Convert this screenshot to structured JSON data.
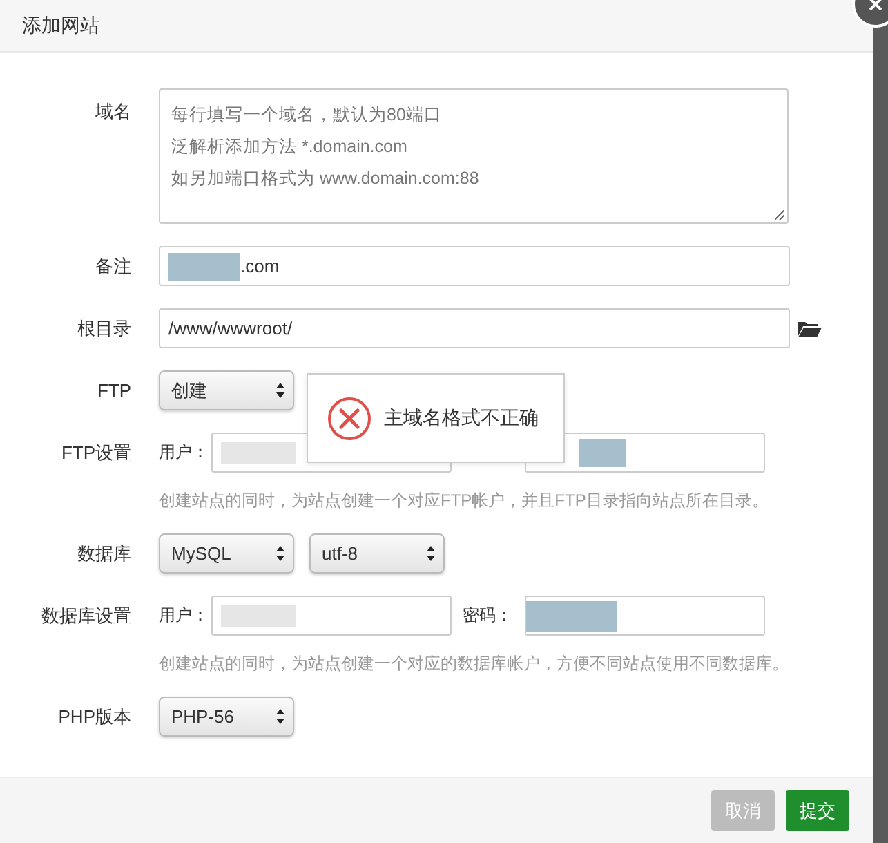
{
  "dialog": {
    "title": "添加网站"
  },
  "domain": {
    "label": "域名",
    "placeholder_lines": [
      "每行填写一个域名，默认为80端口",
      "泛解析添加方法 *.domain.com",
      "如另加端口格式为 www.domain.com:88"
    ]
  },
  "note": {
    "label": "备注",
    "value": ".com",
    "redacted": true
  },
  "root": {
    "label": "根目录",
    "value": "/www/wwwroot/"
  },
  "ftp": {
    "label": "FTP",
    "select": "创建"
  },
  "ftp_settings": {
    "label": "FTP设置",
    "user_label": "用户：",
    "user_redacted": true,
    "password_redacted": true,
    "hint": "创建站点的同时，为站点创建一个对应FTP帐户，并且FTP目录指向站点所在目录。"
  },
  "database": {
    "label": "数据库",
    "selects": [
      "MySQL",
      "utf-8"
    ]
  },
  "database_settings": {
    "label": "数据库设置",
    "user_label": "用户：",
    "password_label": "密码：",
    "user_redacted": true,
    "password_redacted": true,
    "hint": "创建站点的同时，为站点创建一个对应的数据库帐户，方便不同站点使用不同数据库。"
  },
  "php": {
    "label": "PHP版本",
    "select": "PHP-56"
  },
  "toast": {
    "kind": "error",
    "message": "主域名格式不正确"
  },
  "buttons": [
    {
      "label": "取消",
      "kind": "cancel",
      "disabled": true
    },
    {
      "label": "提交",
      "kind": "submit",
      "disabled": false
    }
  ]
}
